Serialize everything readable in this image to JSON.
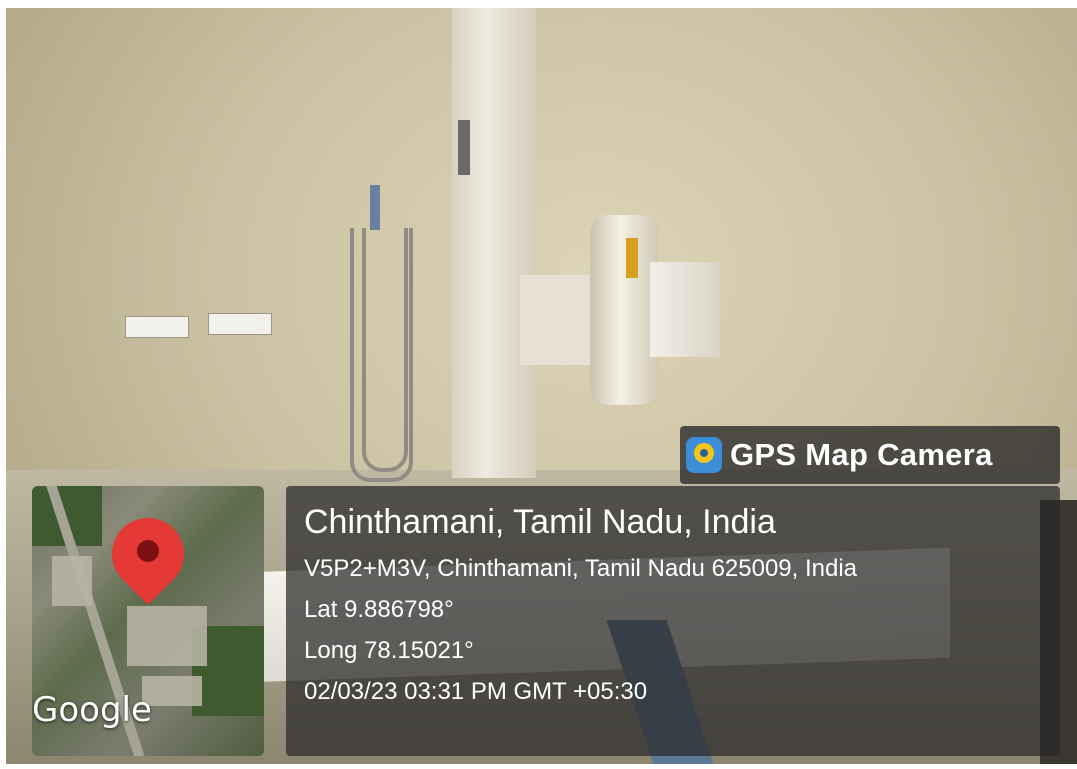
{
  "watermark": {
    "brand": "GPS Map Camera",
    "brand_icon": "gps-map-camera-app-icon",
    "map_credit": "Google"
  },
  "location": {
    "title": "Chinthamani, Tamil Nadu, India",
    "address": "V5P2+M3V, Chinthamani, Tamil Nadu 625009, India",
    "lat": "Lat 9.886798°",
    "long": "Long 78.15021°",
    "timestamp": "02/03/23 03:31 PM GMT +05:30"
  },
  "colors": {
    "pin": "#e53935",
    "overlay": "#282828"
  }
}
